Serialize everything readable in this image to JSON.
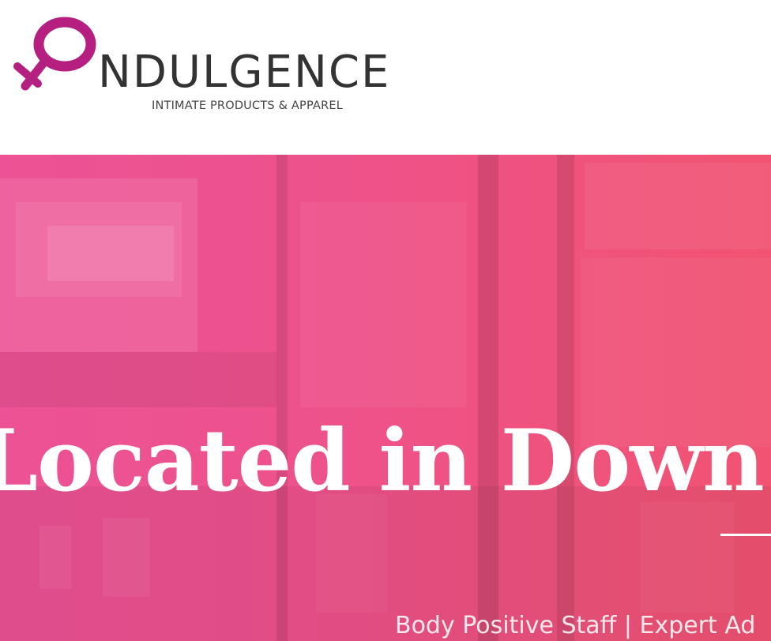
{
  "brand": {
    "name": "NDULGENCE",
    "tagline": "INTIMATE PRODUCTS & APPAREL",
    "colors": {
      "symbol": "#b51f7f",
      "wordmark": "#333333"
    },
    "icon": "venus-symbol-icon"
  },
  "hero": {
    "title": "Located in Down",
    "subtitle": "Body Positive Staff | Expert Ad",
    "colors": {
      "overlay_left": "#ec4f93",
      "overlay_right": "#f1506f",
      "text": "#ffffff"
    }
  }
}
